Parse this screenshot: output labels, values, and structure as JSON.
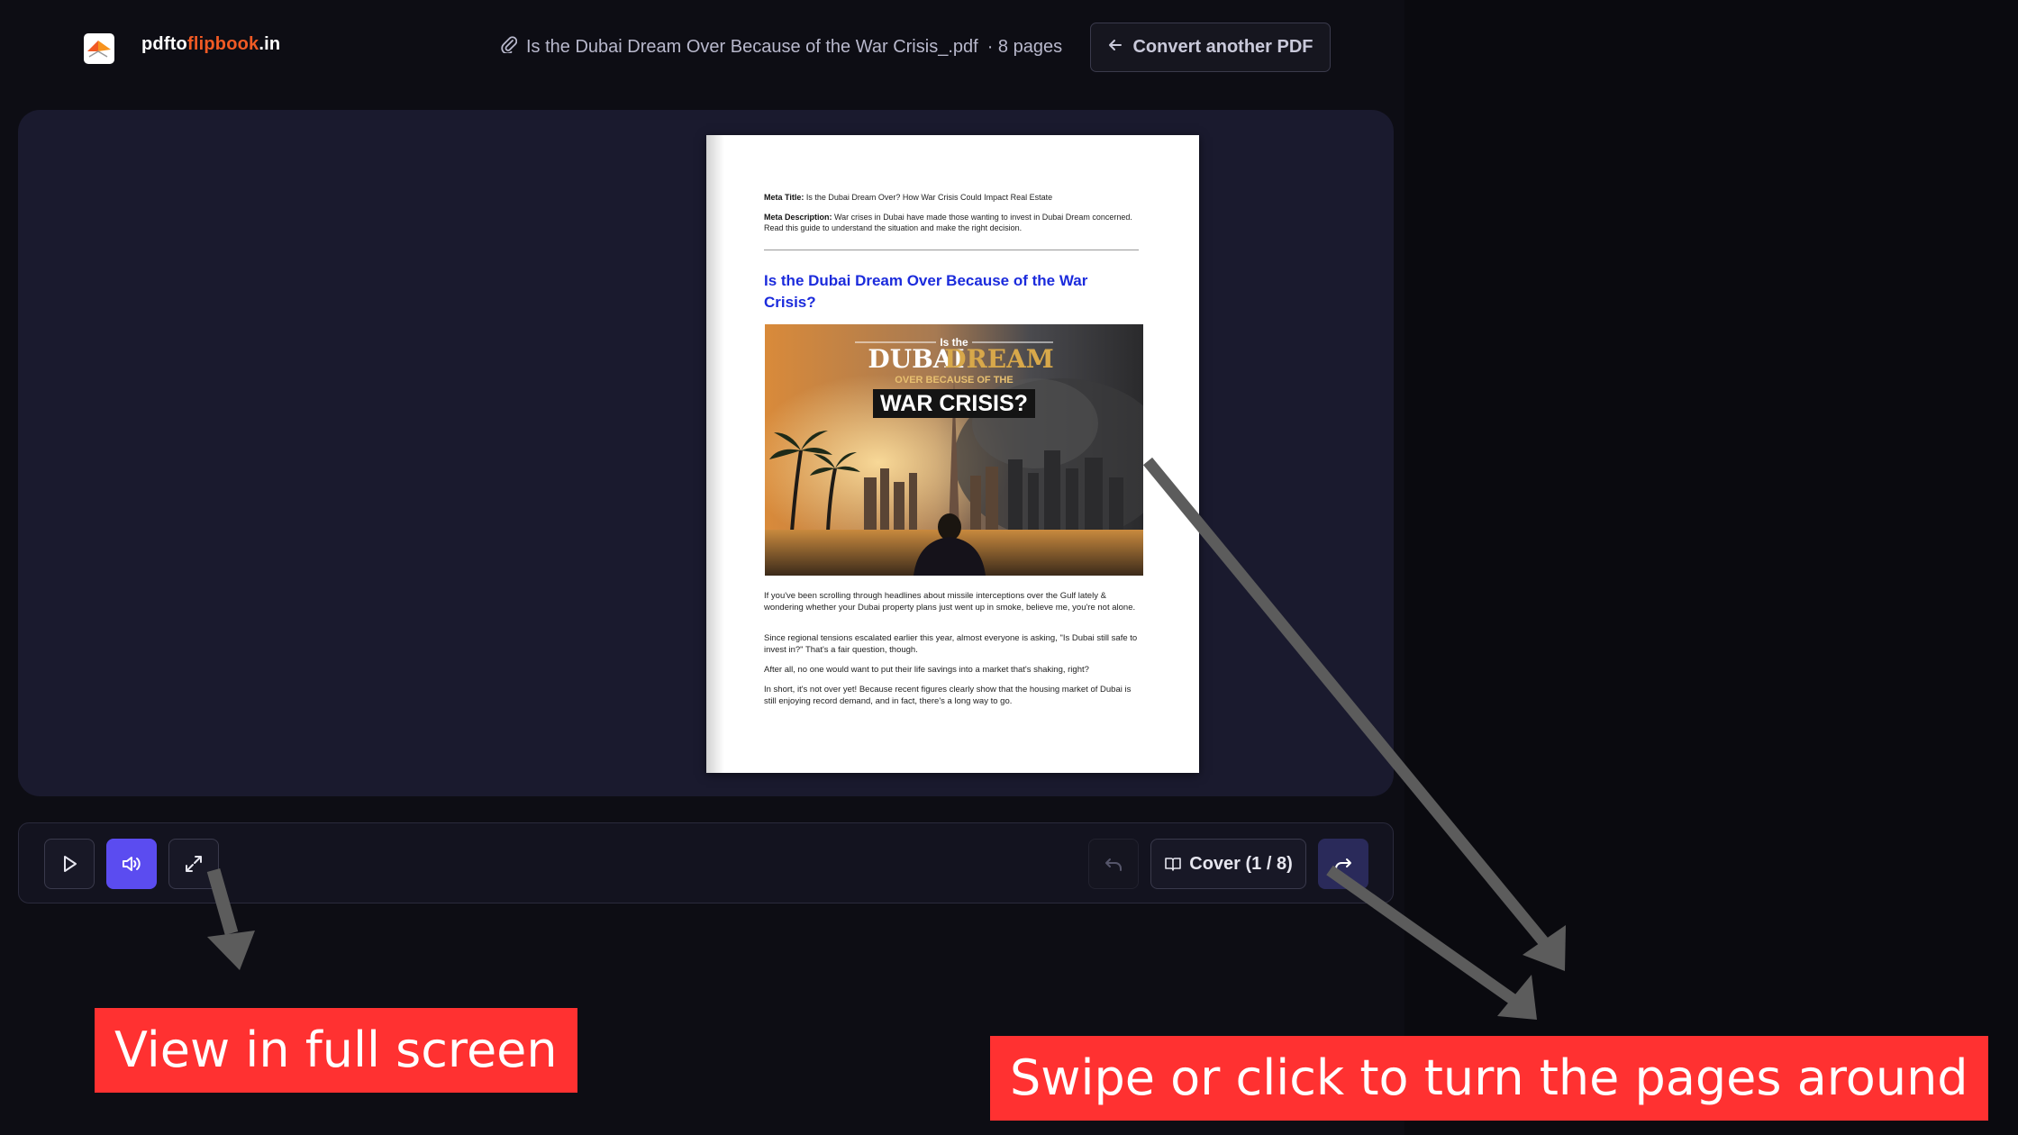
{
  "header": {
    "logo_part1": "pdfto",
    "logo_part2": "flipbook",
    "logo_part3": ".in",
    "file_name": "Is the Dubai Dream Over Because of the War Crisis_.pdf",
    "file_pages": "· 8 pages",
    "convert_label": "Convert another PDF"
  },
  "page": {
    "meta_title_label": "Meta Title:",
    "meta_title_value": " Is the Dubai Dream Over? How War Crisis Could Impact Real Estate",
    "meta_desc_label": "Meta Description:",
    "meta_desc_value": " War crises in Dubai have made those wanting to invest in Dubai Dream concerned. Read this guide to understand the situation and make the right decision.",
    "title": "Is the Dubai Dream Over Because of the War Crisis?",
    "hero": {
      "line1": "Is the",
      "line2a": "DUBAI",
      "line2b": "DREAM",
      "line3": "OVER BECAUSE OF THE",
      "line4": "WAR CRISIS?"
    },
    "paragraphs": [
      "If you've been scrolling through headlines about missile interceptions over the Gulf lately & wondering whether your Dubai property plans just went up in smoke, believe me, you're not alone.",
      "Since regional tensions escalated earlier this year, almost everyone is asking, \"Is Dubai still safe to invest in?\" That's a fair question, though.",
      "After all, no one would want to put their life savings into a market that's shaking, right?",
      "In short, it's not over yet! Because recent figures clearly show that the housing market of Dubai is still enjoying record demand, and in fact, there's a long way to go."
    ]
  },
  "controls": {
    "cover_label": "Cover (1 / 8)",
    "active_color": "#5b4cf0"
  },
  "annotations": {
    "fullscreen": "View in full screen",
    "swipe": "Swipe or click to turn the pages around",
    "callout_color": "#ff3131"
  }
}
